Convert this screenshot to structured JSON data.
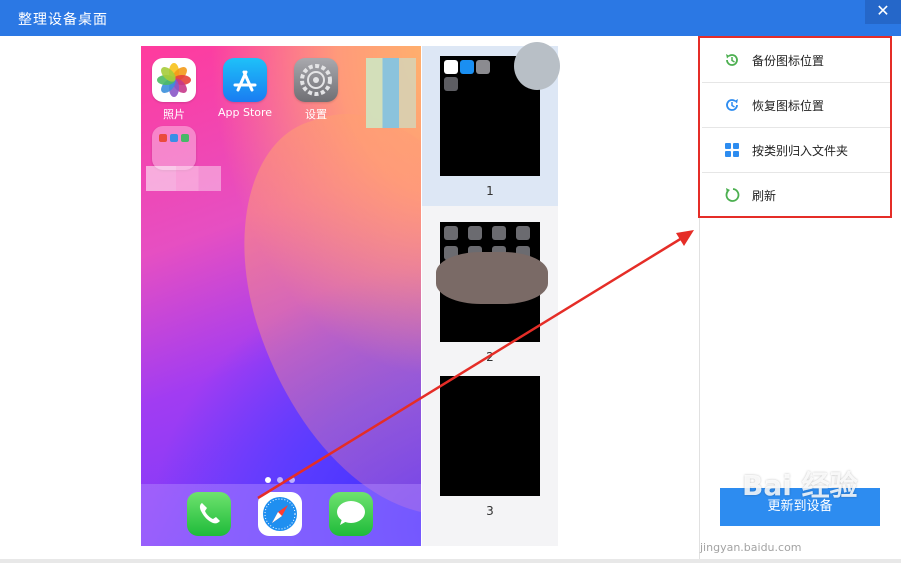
{
  "window": {
    "title": "整理设备桌面",
    "close_glyph": "✕"
  },
  "home_screen": {
    "apps": [
      {
        "label": "照片",
        "icon": "photos-icon"
      },
      {
        "label": "App Store",
        "icon": "app-store-icon"
      },
      {
        "label": "设置",
        "icon": "settings-icon"
      }
    ],
    "dock_apps": [
      "phone-icon",
      "safari-icon",
      "messages-icon"
    ],
    "page_dots": 3,
    "active_dot": 1
  },
  "pages": [
    {
      "number": "1",
      "selected": true
    },
    {
      "number": "2",
      "selected": false
    },
    {
      "number": "3",
      "selected": false
    }
  ],
  "menu": {
    "items": [
      {
        "label": "备份图标位置",
        "icon": "backup-clock-icon"
      },
      {
        "label": "恢复图标位置",
        "icon": "restore-clock-icon"
      },
      {
        "label": "按类别归入文件夹",
        "icon": "grid-folders-icon"
      },
      {
        "label": "刷新",
        "icon": "refresh-icon"
      }
    ]
  },
  "apply_button": {
    "label": "更新到设备"
  },
  "watermark": {
    "text": "Bai 经验",
    "url": "jingyan.baidu.com"
  },
  "colors": {
    "title_bar": "#2b78e4",
    "highlight_border": "#e52d27",
    "apply_button": "#2d8cf0",
    "arrow": "#e52d27"
  }
}
